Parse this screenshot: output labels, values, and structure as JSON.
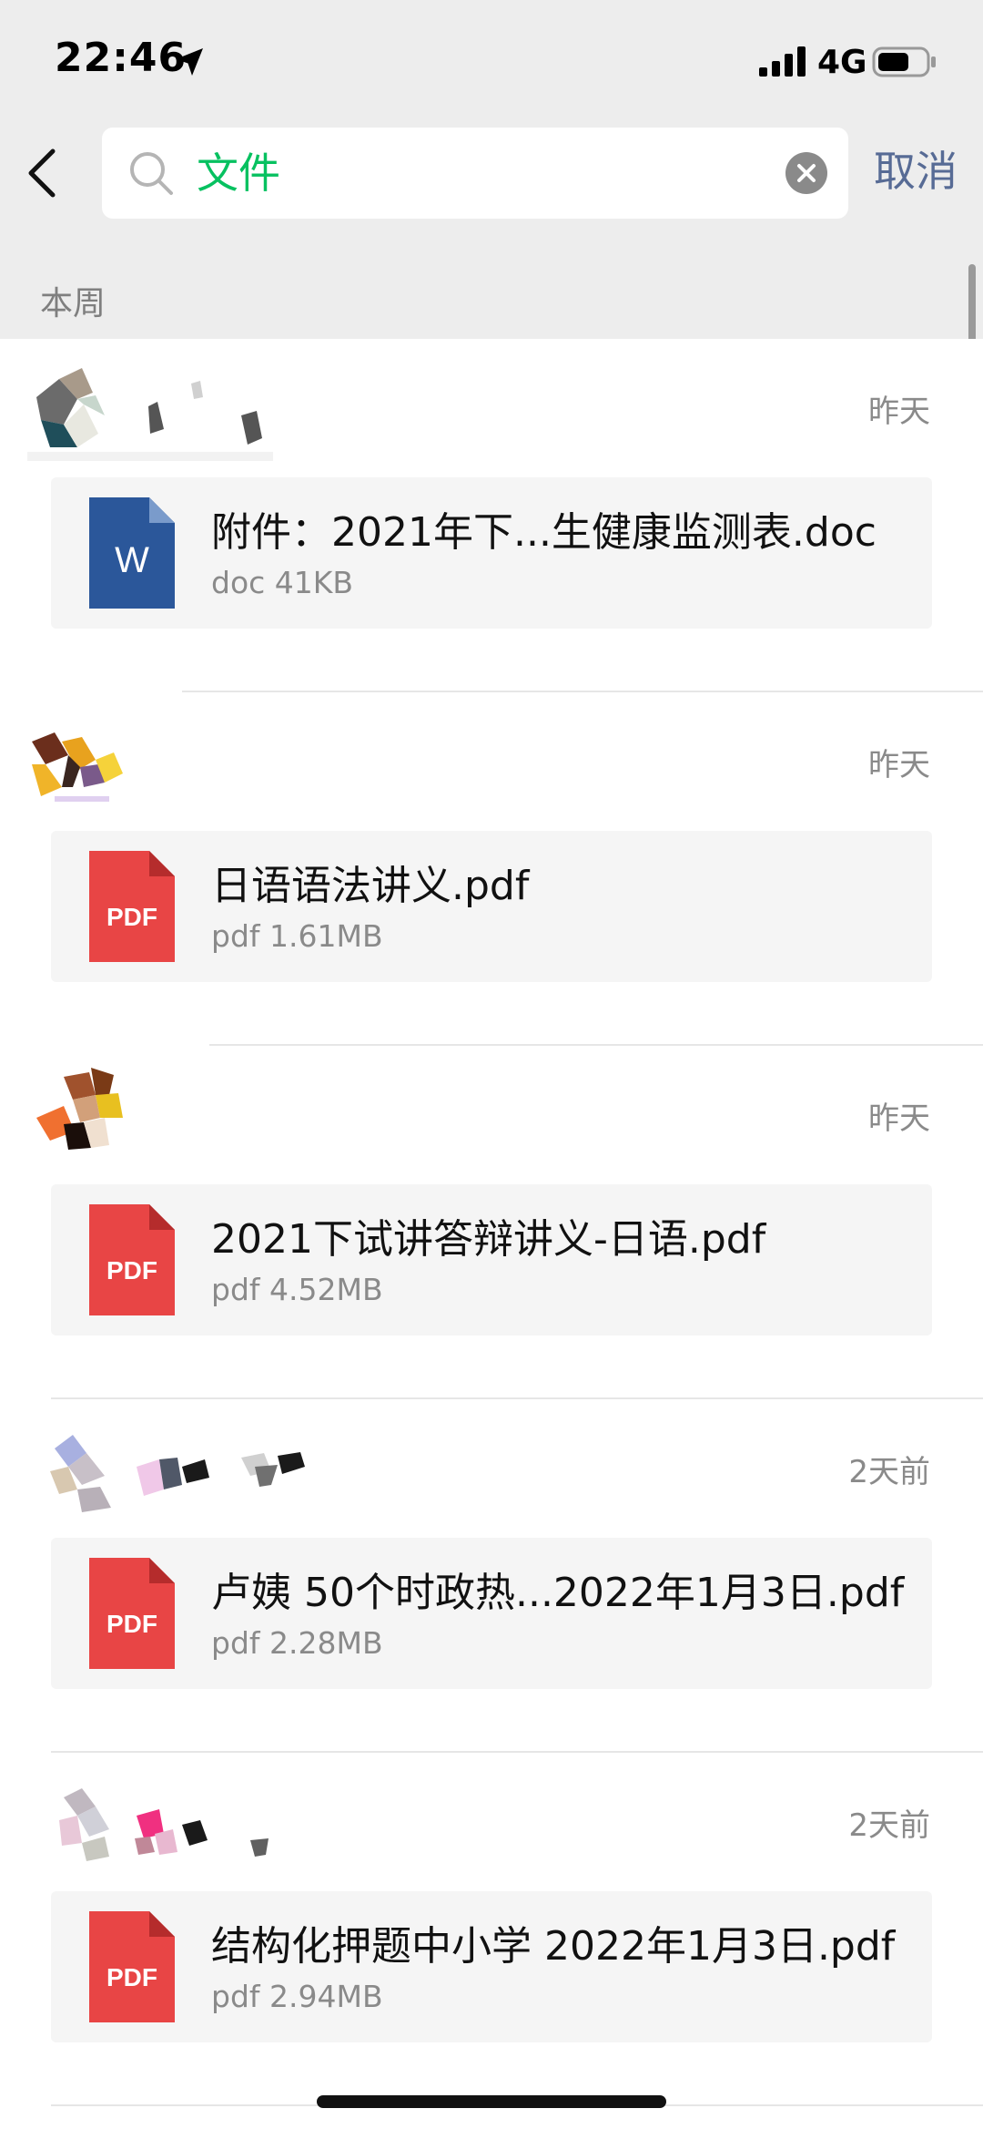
{
  "status_bar": {
    "time": "22:46",
    "network": "4G"
  },
  "search": {
    "query": "文件",
    "cancel_label": "取消"
  },
  "section": {
    "title": "本周"
  },
  "results": [
    {
      "time": "昨天",
      "file_name": "附件：2021年下...生健康监测表.doc",
      "meta": "doc 41KB",
      "type": "doc"
    },
    {
      "time": "昨天",
      "file_name": "日语语法讲义.pdf",
      "meta": "pdf 1.61MB",
      "type": "pdf"
    },
    {
      "time": "昨天",
      "file_name": "2021下试讲答辩讲义-日语.pdf",
      "meta": "pdf 4.52MB",
      "type": "pdf"
    },
    {
      "time": "2天前",
      "file_name": "卢姨 50个时政热...2022年1月3日.pdf",
      "meta": "pdf 2.28MB",
      "type": "pdf"
    },
    {
      "time": "2天前",
      "file_name": "结构化押题中小学 2022年1月3日.pdf",
      "meta": "pdf 2.94MB",
      "type": "pdf"
    }
  ],
  "icons": {
    "doc_label": "W",
    "pdf_label": "PDF"
  },
  "colors": {
    "search_accent": "#07c160",
    "cancel": "#576b95",
    "pdf_red": "#e84545",
    "doc_blue": "#2b579a"
  }
}
